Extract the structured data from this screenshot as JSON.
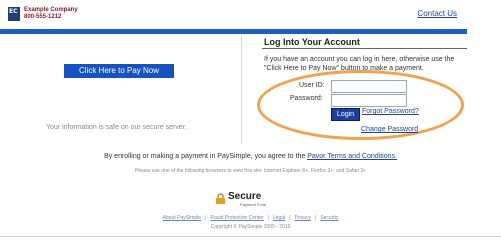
{
  "header": {
    "company_name": "Example Company",
    "company_phone": "800-555-1212",
    "logo_letters": "EC",
    "contact_label": "Contact Us"
  },
  "left_panel": {
    "pay_now_label": "Click Here to Pay Now",
    "safe_text": "Your information is safe on our secure server."
  },
  "login": {
    "title": "Log Into Your Account",
    "description": "If you have an account you can log in here, otherwise use the \"Click Here to Pay Now\" button to make a payment.",
    "user_id_label": "User ID:",
    "password_label": "Password:",
    "user_id_value": "",
    "password_value": "",
    "login_button": "Login",
    "forgot_password": "Forgot Password?",
    "change_password": "Change Password"
  },
  "agreement": {
    "text": "By enrolling or making a payment in PaySimple, you agree to the",
    "link": "Pavor Terms and Conditions."
  },
  "browsers_note": "Please use one of the following browsers to view this site: Internet Explorer 6+, Firefox 3+, and Safari 3+",
  "secure_badge": {
    "title": "Secure",
    "subtitle": "Payment Form"
  },
  "footer": {
    "links": [
      "About PaySimple",
      "Fraud Protection Center",
      "Legal",
      "Privacy",
      "Security"
    ],
    "copyright": "Copyright © PaySimple 2005 - 2010"
  },
  "colors": {
    "accent_blue": "#1d5fc4",
    "highlight_orange": "#f2a24a",
    "brand_red": "#8a1c2a"
  }
}
